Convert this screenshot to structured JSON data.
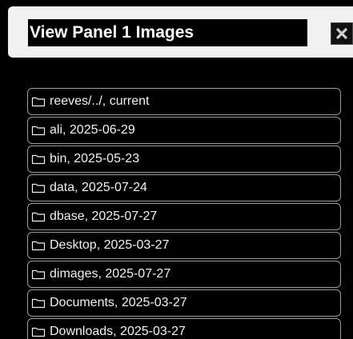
{
  "header": {
    "title": "View Panel 1 Images",
    "close_icon": "close-icon"
  },
  "colors": {
    "background": "#000000",
    "header_background": "#f1f1f1",
    "item_border": "#9a9a9a",
    "text": "#f2f2f2"
  },
  "folders": {
    "icon": "folder-icon",
    "items": [
      {
        "label": "reeves/../, current"
      },
      {
        "label": "ali, 2025-06-29"
      },
      {
        "label": "bin, 2025-05-23"
      },
      {
        "label": "data, 2025-07-24"
      },
      {
        "label": "dbase, 2025-07-27"
      },
      {
        "label": "Desktop, 2025-03-27"
      },
      {
        "label": "dimages, 2025-07-27"
      },
      {
        "label": "Documents, 2025-03-27"
      },
      {
        "label": "Downloads, 2025-03-27"
      }
    ]
  }
}
